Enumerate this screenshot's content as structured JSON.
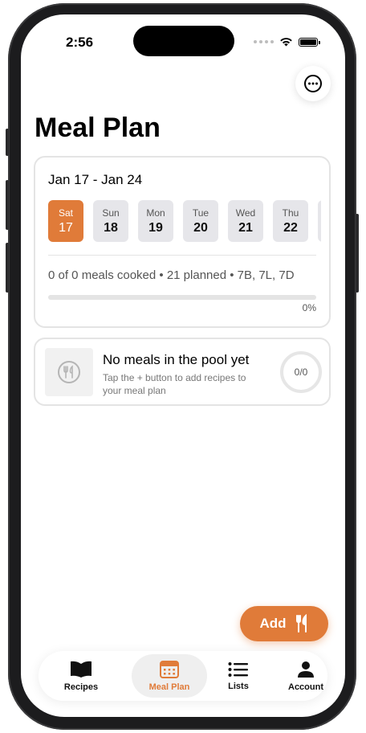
{
  "status": {
    "time": "2:56"
  },
  "header": {
    "title": "Meal Plan"
  },
  "week": {
    "range": "Jan 17 - Jan 24",
    "days": [
      {
        "name": "Sat",
        "num": "17"
      },
      {
        "name": "Sun",
        "num": "18"
      },
      {
        "name": "Mon",
        "num": "19"
      },
      {
        "name": "Tue",
        "num": "20"
      },
      {
        "name": "Wed",
        "num": "21"
      },
      {
        "name": "Thu",
        "num": "22"
      }
    ],
    "summary": "0 of 0 meals cooked • 21 planned • 7B, 7L, 7D",
    "progress_value": 0,
    "progress_label": "0%"
  },
  "pool": {
    "title": "No meals in the pool yet",
    "subtitle": "Tap the + button to add recipes to your meal plan",
    "count": "0/0"
  },
  "add_button": {
    "label": "Add"
  },
  "tabs": [
    {
      "label": "Recipes"
    },
    {
      "label": "Meal Plan"
    },
    {
      "label": "Lists"
    },
    {
      "label": "Account"
    }
  ],
  "colors": {
    "accent": "#e07b39"
  },
  "icons": [
    "more-icon",
    "fork-knife-icon",
    "book-icon",
    "calendar-icon",
    "list-icon",
    "person-icon"
  ]
}
